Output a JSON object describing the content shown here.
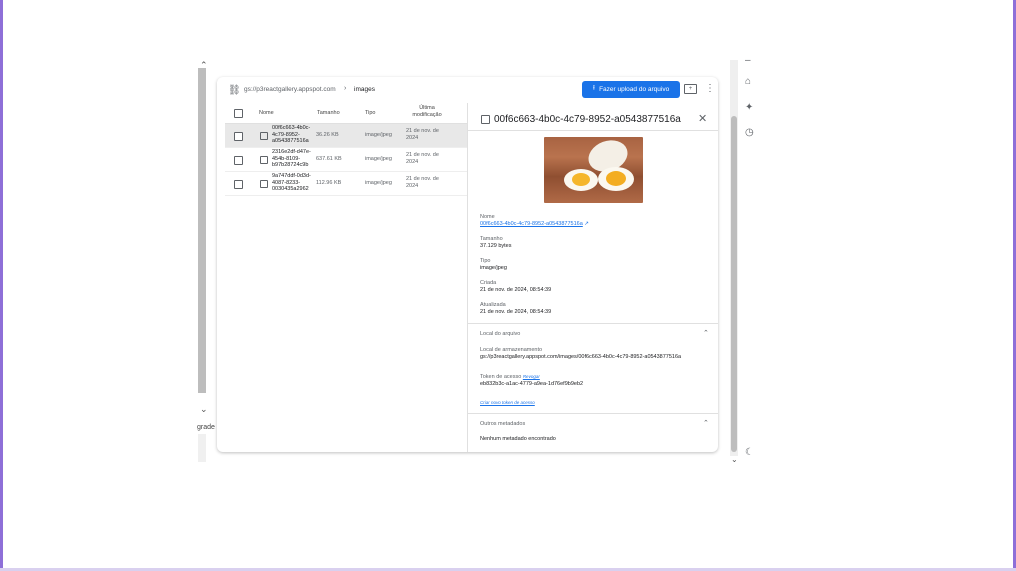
{
  "left": {
    "bottom_label": "grade"
  },
  "path": {
    "bucket": "gs://p3reactgallery.appspot.com",
    "separator": "›",
    "folder": "images"
  },
  "toolbar": {
    "upload_label": "Fazer upload do arquivo",
    "upload_icon": "⭱",
    "folder_icon": "+",
    "menu_icon": "⋮"
  },
  "table": {
    "headers": {
      "name": "Nome",
      "size": "Tamanho",
      "type": "Tipo",
      "modified": "Última modificação"
    },
    "rows": [
      {
        "name": "00f6c663-4b0c-4c79-8952-a0543877516a",
        "size": "36.26 KB",
        "type": "image/jpeg",
        "modified": "21 de nov. de 2024"
      },
      {
        "name": "2316e2df-d47e-454b-8109-b97b28724c9b",
        "size": "637.61 KB",
        "type": "image/jpeg",
        "modified": "21 de nov. de 2024"
      },
      {
        "name": "9a747ddf-0d3d-4087-8233-0030435a2962",
        "size": "112.96 KB",
        "type": "image/jpeg",
        "modified": "21 de nov. de 2024"
      }
    ]
  },
  "panel": {
    "title": "00f6c663-4b0c-4c79-8952-a0543877516a",
    "close_icon": "✕",
    "image_alt": "",
    "name_label": "Nome",
    "name_value": "00f6c663-4b0c-4c79-8952-a0543877516a",
    "size_label": "Tamanho",
    "size_value": "37.129 bytes",
    "type_label": "Tipo",
    "type_value": "image/jpeg",
    "created_label": "Criada",
    "created_value": "21 de nov. de 2024, 08:54:39",
    "updated_label": "Atualizada",
    "updated_value": "21 de nov. de 2024, 08:54:39",
    "location_section": "Local do arquivo",
    "storage_label": "Local de armazenamento",
    "storage_value": "gs://p3reactgallery.appspot.com/images/00f6c663-4b0c-4c79-8952-a0543877516a",
    "token_label": "Token de acesso",
    "token_revoke": "Revogar",
    "token_value": "eb832b3c-a1ac-4779-a9ea-1d76ef9b9eb2",
    "new_token": "Criar novo token de acesso",
    "other_section": "Outros metadados",
    "other_value": "Nenhum metadado encontrado",
    "chevron_up": "⌃"
  },
  "rail_icons": [
    "⌂",
    "✦",
    "◷",
    "☾"
  ]
}
